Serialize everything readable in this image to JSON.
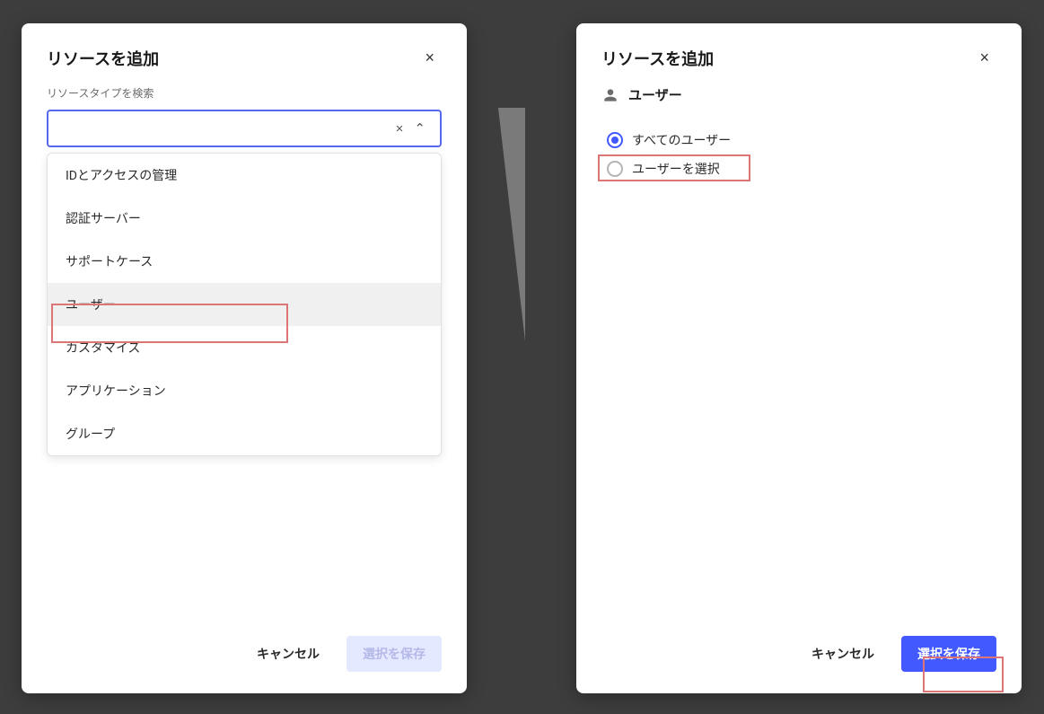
{
  "dialog_left": {
    "title": "リソースを追加",
    "close_symbol": "×",
    "field_label": "リソースタイプを検索",
    "combobox": {
      "value": "",
      "clear_symbol": "×",
      "chevron_symbol": "⌃"
    },
    "dropdown_items": [
      {
        "label": "IDとアクセスの管理"
      },
      {
        "label": "認証サーバー"
      },
      {
        "label": "サポートケース"
      },
      {
        "label": "ユーザー"
      },
      {
        "label": "カスタマイズ"
      },
      {
        "label": "アプリケーション"
      },
      {
        "label": "グループ"
      }
    ],
    "footer": {
      "cancel": "キャンセル",
      "save": "選択を保存"
    }
  },
  "dialog_right": {
    "title": "リソースを追加",
    "close_symbol": "×",
    "resource_type": "ユーザー",
    "radio_options": [
      {
        "label": "すべてのユーザー",
        "selected": true
      },
      {
        "label": "ユーザーを選択",
        "selected": false
      }
    ],
    "footer": {
      "cancel": "キャンセル",
      "save": "選択を保存"
    }
  }
}
